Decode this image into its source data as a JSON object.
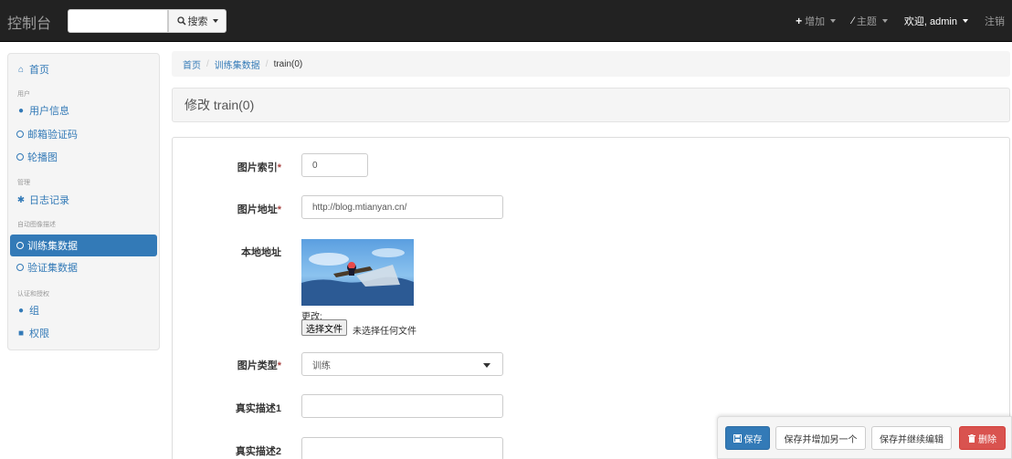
{
  "navbar": {
    "brand": "控制台",
    "search_button": "搜索",
    "add_menu": "增加",
    "theme_menu": "主题",
    "welcome": "欢迎, admin",
    "logout": "注销"
  },
  "sidebar": {
    "home": "首页",
    "section_user": "用户",
    "user_info": "用户信息",
    "email_code": "邮箱验证码",
    "carousel": "轮播图",
    "section_manage": "管理",
    "log_records": "日志记录",
    "section_auto": "自动图像描述",
    "train_data": "训练集数据",
    "val_data": "验证集数据",
    "section_auth": "认证和授权",
    "group": "组",
    "permission": "权限"
  },
  "breadcrumb": {
    "home": "首页",
    "section": "训练集数据",
    "current": "train(0)"
  },
  "page": {
    "title": "修改 train(0)"
  },
  "form": {
    "image_index_label": "图片索引",
    "image_index_value": "0",
    "image_url_label": "图片地址",
    "image_url_value": "http://blog.mtianyan.cn/",
    "local_path_label": "本地地址",
    "change_label": "更改:",
    "choose_file_button": "选择文件",
    "no_file_text": "未选择任何文件",
    "image_type_label": "图片类型",
    "image_type_value": "训练",
    "desc1_label": "真实描述1",
    "desc1_value": "",
    "desc2_label": "真实描述2",
    "desc2_value": "",
    "required_mark": "*"
  },
  "actions": {
    "save": "保存",
    "save_add_another": "保存并增加另一个",
    "save_continue": "保存并继续编辑",
    "delete": "删除"
  },
  "colors": {
    "navbar_bg": "#222222",
    "primary": "#337ab7",
    "danger": "#d9534f"
  }
}
